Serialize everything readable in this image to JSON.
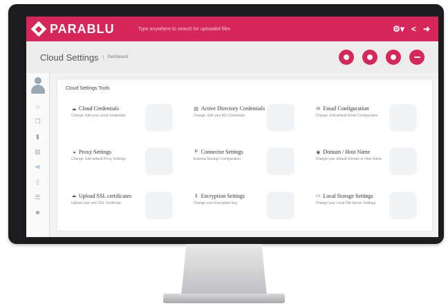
{
  "app": {
    "logo_text": "PARABLU",
    "search_placeholder": "Type anywhere to search for uploaded files"
  },
  "topbar_icons": [
    "gear-icon",
    "share-icon",
    "logout-icon"
  ],
  "page": {
    "title": "Cloud Settings",
    "subtitle": "Dashboard"
  },
  "header_buttons": [
    "upload-icon",
    "download-icon",
    "folder-icon",
    "minus-icon"
  ],
  "sidebar_icons": [
    "home-icon",
    "files-icon",
    "trash-icon",
    "chart-icon",
    "share-network-icon",
    "document-icon",
    "list-icon",
    "users-icon"
  ],
  "content": {
    "title": "Cloud Settings Tools",
    "tiles": [
      {
        "icon": "cloud-icon",
        "glyph": "☁",
        "title": "Cloud Credentials",
        "desc": "Change, Edit your cloud credentials"
      },
      {
        "icon": "directory-icon",
        "glyph": "▤",
        "title": "Active Directory Credentials",
        "desc": "Change, Edit your AD Credentials"
      },
      {
        "icon": "envelope-icon",
        "glyph": "✉",
        "title": "Email Configuration",
        "desc": "Change, Edit default Email Configuration"
      },
      {
        "icon": "speaker-icon",
        "glyph": "◂",
        "title": "Proxy Settings",
        "desc": "Change, Edit default Proxy Settings"
      },
      {
        "icon": "connector-icon",
        "glyph": "P",
        "title": "Connector Settings",
        "desc": "External Storage Configuration"
      },
      {
        "icon": "globe-icon",
        "glyph": "◉",
        "title": "Domain / Host Name",
        "desc": "Change your default Domain or Host Name"
      },
      {
        "icon": "cloud-upload-icon",
        "glyph": "☁",
        "title": "Upload SSL certificates",
        "desc": "Upload your own SSL Certificate"
      },
      {
        "icon": "key-icon",
        "glyph": "⚷",
        "title": "Encryption Settings",
        "desc": "Change your Encryption Key"
      },
      {
        "icon": "storage-icon",
        "glyph": "▭",
        "title": "Local Storage Settings",
        "desc": "Change your Local File Server Settings"
      }
    ]
  },
  "colors": {
    "brand": "#d6275a",
    "monitor": "#1c1c1e"
  }
}
